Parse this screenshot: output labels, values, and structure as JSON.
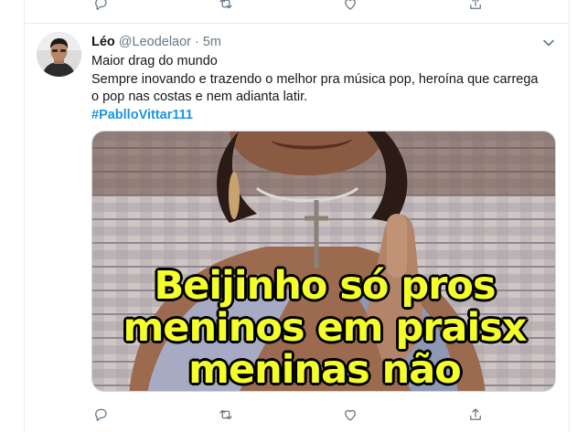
{
  "tweet": {
    "display_name": "Léo",
    "handle": "@Leodelaor",
    "separator": "·",
    "time": "5m",
    "lines": [
      "Maior drag do mundo",
      "Sempre inovando e trazendo o melhor pra música pop, heroína que carrega",
      "o pop nas costas e nem adianta latir."
    ],
    "hashtag": "#PablloVittar111",
    "media": {
      "caption_lines": [
        "Beijinho só pros",
        "meninos em praisx",
        "meninas não"
      ]
    }
  },
  "actions": [
    "reply-icon",
    "retweet-icon",
    "like-icon",
    "share-icon"
  ],
  "colors": {
    "hashtag": "#1b95e0",
    "muted_text": "#657786",
    "divider": "#e6ecf0",
    "caption_fill": "#f4ff2a"
  }
}
